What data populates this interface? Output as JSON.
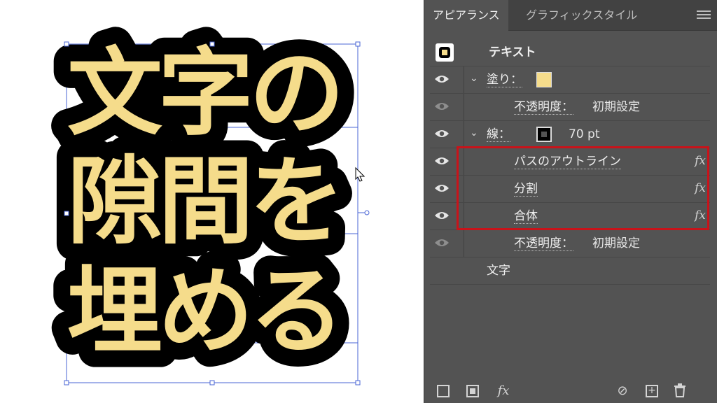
{
  "canvas": {
    "text_lines": [
      "文字の",
      "隙間を",
      "埋める"
    ],
    "colors": {
      "fill": "#f5dc8b",
      "stroke": "#000000",
      "selection": "#4a66d6"
    }
  },
  "panel": {
    "tabs": [
      {
        "label": "アピアランス",
        "active": true
      },
      {
        "label": "グラフィックスタイル",
        "active": false
      }
    ],
    "menu_icon": "hamburger-menu-icon",
    "object_label": "テキスト",
    "rows": [
      {
        "label": "塗り：",
        "swatch": "#f5dc8b"
      },
      {
        "label": "不透明度：",
        "value": "初期設定"
      },
      {
        "label": "線：",
        "swatch": "#000000",
        "value": "70 pt"
      },
      {
        "label": "パスのアウトライン",
        "fx": "fx"
      },
      {
        "label": "分割",
        "fx": "fx"
      },
      {
        "label": "合体",
        "fx": "fx"
      },
      {
        "label": "不透明度：",
        "value": "初期設定"
      },
      {
        "label": "文字"
      }
    ],
    "highlight_color": "#c8131a",
    "bottom_icons": [
      "new-stroke-icon",
      "new-fill-icon",
      "add-effect-icon",
      "clear-appearance-icon",
      "duplicate-item-icon",
      "delete-item-icon"
    ],
    "fx_label": "fx"
  }
}
